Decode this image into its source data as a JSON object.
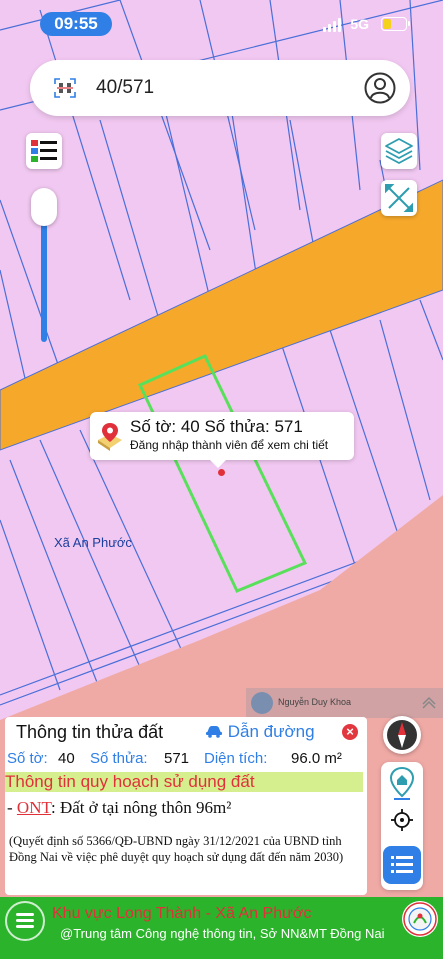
{
  "status": {
    "time": "09:55",
    "network": "5G"
  },
  "search": {
    "value": "40/571"
  },
  "popup": {
    "title": "Số tờ: 40 Số thửa: 571",
    "subtitle": "Đăng nhập thành viên để xem chi tiết"
  },
  "map": {
    "place_label": "Xã An Phước",
    "user_name": "Nguyễn Duy Khoa"
  },
  "info": {
    "title": "Thông tin thửa đất",
    "directions": "Dẫn đường",
    "sheet_label": "Số tờ:",
    "sheet_value": "40",
    "parcel_label": "Số thửa:",
    "parcel_value": "571",
    "area_label": "Diện tích:",
    "area_value": "96.0 m²",
    "section_title": "Thông tin quy hoạch sử dụng đất",
    "ont_prefix": "- ",
    "ont_code": "ONT",
    "ont_text": ": Đất ở tại nông thôn 96m²",
    "note": "(Quyết định số 5366/QĐ-UBND ngày 31/12/2021 của UBND tỉnh Đồng Nai về việc phê duyệt quy hoạch sử dụng đất đến năm 2030)"
  },
  "footer": {
    "title": "Khu vực Long Thành - Xã An Phước",
    "subtitle": "@Trung tâm Công nghệ thông tin, Sở NN&MT Đồng Nai"
  },
  "colors": {
    "accent": "#2f7fe6",
    "map_bg": "#f1c8f1",
    "road": "#f6a82b",
    "parcel_outline": "#59e05b",
    "zone": "#f0aaa6",
    "footer": "#2bb42b"
  }
}
